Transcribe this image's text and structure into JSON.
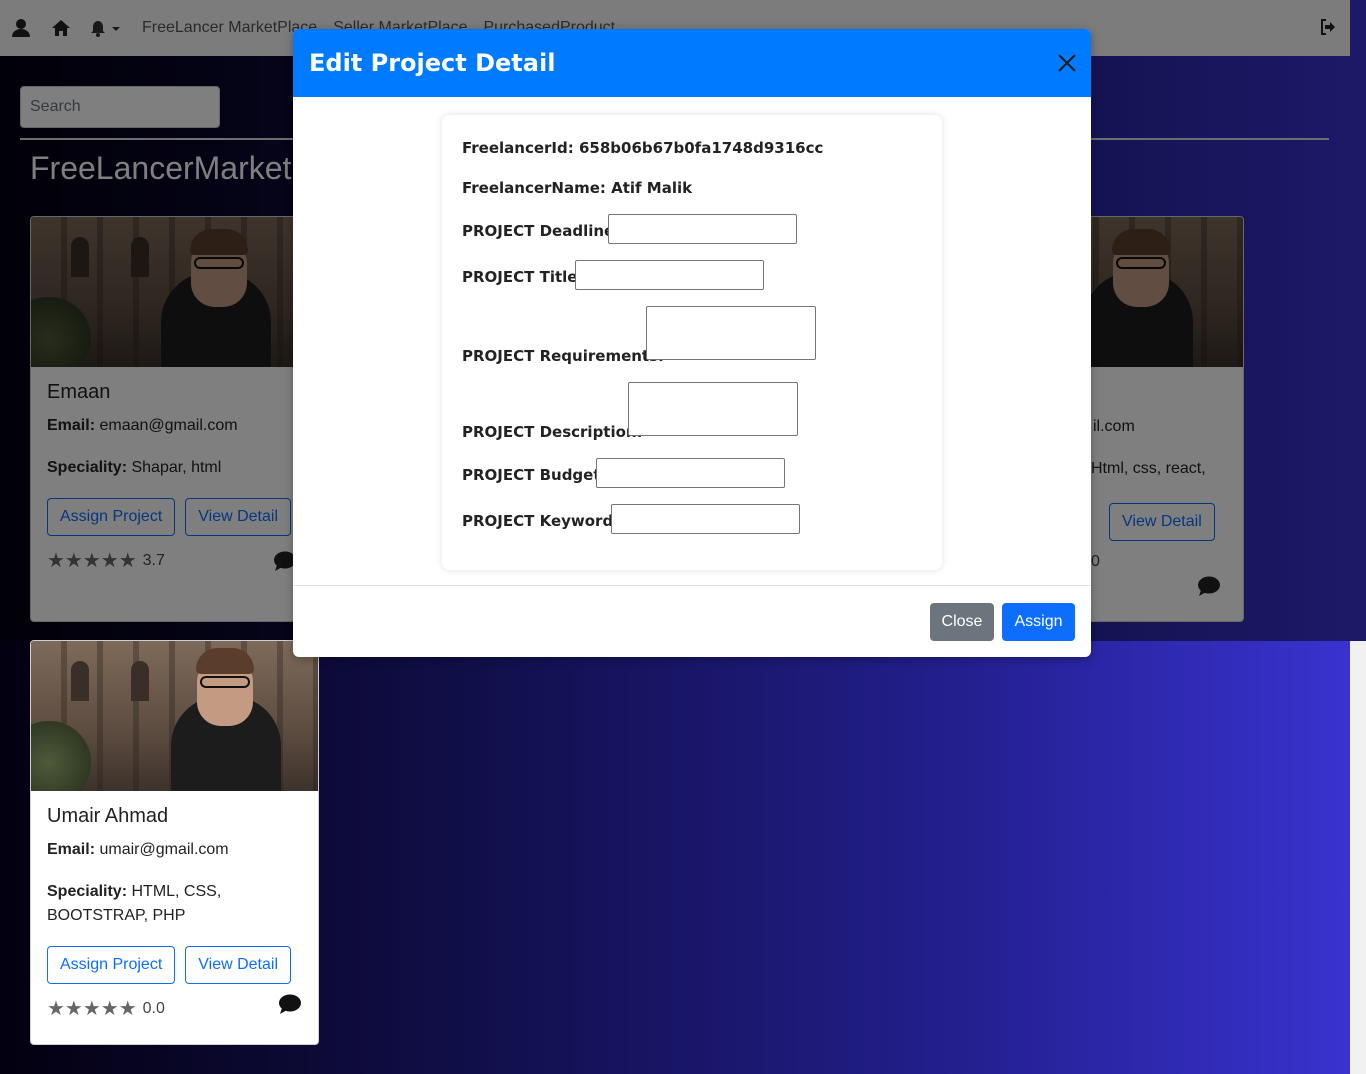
{
  "nav": {
    "links": [
      "FreeLancer MarketPlace",
      "Seller MarketPlace",
      "PurchasedProduct"
    ]
  },
  "search": {
    "placeholder": "Search"
  },
  "page": {
    "title": "FreeLancerMarket"
  },
  "cards": [
    {
      "name": "Emaan",
      "email_label": "Email:",
      "email": "emaan@gmail.com",
      "speciality_label": "Speciality:",
      "speciality": "Shapar, html",
      "assign_label": "Assign Project",
      "view_label": "View Detail",
      "stars": "★★★★★",
      "rating": "3.7"
    },
    {
      "email_fragment": "il.com",
      "speciality_fragment": "Html, css, react,",
      "view_label": "View Detail",
      "rating_fragment": "0"
    },
    {
      "name": "Umair Ahmad",
      "email_label": "Email:",
      "email": "umair@gmail.com",
      "speciality_label": "Speciality:",
      "speciality": "HTML, CSS, BOOTSTRAP, PHP",
      "assign_label": "Assign Project",
      "view_label": "View Detail",
      "stars": "★★★★★",
      "rating": "0.0"
    }
  ],
  "modal": {
    "title": "Edit Project Detail",
    "freelancer_id": "FreelancerId: 658b06b67b0fa1748d9316cc",
    "freelancer_name": "FreelancerName: Atif Malik",
    "fields": {
      "deadline": "PROJECT Deadline:",
      "title": "PROJECT Title:",
      "requirements": "PROJECT Requirements:",
      "description": "PROJECT Description:",
      "budget": "PROJECT Budget:",
      "keywords": "PROJECT Keywords:"
    },
    "close_label": "Close",
    "assign_label": "Assign"
  },
  "colors": {
    "modal_header": "#007bff",
    "primary": "#0d6efd",
    "secondary": "#6c757d"
  }
}
